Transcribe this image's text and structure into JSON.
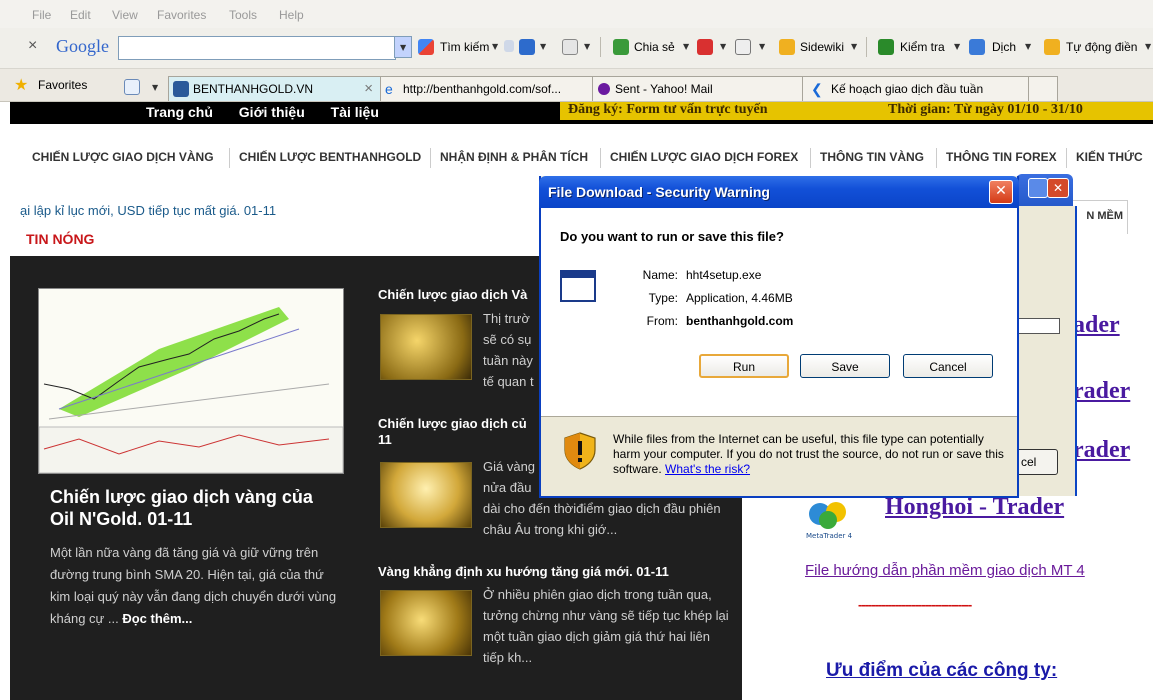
{
  "menubar": {
    "items": [
      "File",
      "Edit",
      "View",
      "Favorites",
      "Tools",
      "Help"
    ]
  },
  "google_toolbar": {
    "close": "×",
    "brand": "Google",
    "search_value": "",
    "search_label": "Tìm kiếm",
    "share_label": "Chia sẻ",
    "sidewiki_label": "Sidewiki",
    "check_label": "Kiểm tra",
    "translate_label": "Dịch",
    "autofill_label": "Tự động điền"
  },
  "favorites_bar": {
    "favorites_label": "Favorites",
    "tabs": [
      {
        "label": "BENTHANHGOLD.VN",
        "close": "×"
      },
      {
        "label": "http://benthanhgold.com/sof..."
      },
      {
        "label": "Sent - Yahoo! Mail"
      },
      {
        "label": "Kế hoạch giao dịch đầu tuần"
      }
    ]
  },
  "site": {
    "top_nav": [
      "Trang chủ",
      "Giới thiệu",
      "Tài liệu"
    ],
    "marquee_left": "Đăng ký:   Form tư vấn trực tuyến",
    "marquee_right": "Thời gian: Từ ngày 01/10 - 31/10",
    "main_menu": [
      "CHIẾN LƯỢC GIAO DỊCH VÀNG",
      "CHIẾN LƯỢC BENTHANHGOLD",
      "NHẬN ĐỊNH & PHÂN TÍCH",
      "CHIẾN LƯỢC GIAO DỊCH FOREX",
      "THÔNG TIN VÀNG",
      "THÔNG TIN FOREX",
      "KIẾN THỨC"
    ],
    "ticker": "ại lập kỉ lục mới, USD tiếp tục mất giá. 01-11",
    "hot_news": "TIN NÓNG",
    "featured": {
      "title": "Chiến lược giao dịch vàng của Oil N'Gold. 01-11",
      "body": "Một lần nữa vàng đã tăng giá và giữ vững trên đường trung bình SMA 20. Hiện tại, giá của thứ kim loại quý này vẫn đang dịch chuyển dưới vùng kháng cự ...",
      "read_more": "Đọc thêm..."
    },
    "articles": [
      {
        "title": "Chiến lược giao dịch Và",
        "text": "Thị trườ\nsẽ có sụ\ntuần này\ntế quan t"
      },
      {
        "title": "Chiến lược giao dịch củ",
        "title2": "11",
        "text": "Giá vàng\nnửa đầu\ndài cho đến thờiđiểm giao dịch đầu phiên châu Âu trong khi giớ..."
      },
      {
        "title": "Vàng khẳng định xu hướng tăng giá mới. 01-11",
        "text": "Ở nhiều phiên giao dịch trong tuần qua, tưởng chừng như vàng sẽ tiếp tục khép lại một tuần giao dịch giảm giá thứ hai liên tiếp kh..."
      }
    ],
    "right": {
      "tab_label": "N MỀM",
      "traders": [
        "ader",
        "rader",
        "rader",
        "Honghoi - Trader"
      ],
      "logo_caption": "MetaTrader 4",
      "mt4_link": "File hướng dẫn phần mềm giao dịch MT 4",
      "dashes": "----------------------------------",
      "advantages": "Ưu điểm của các công ty:"
    }
  },
  "behind_window": {
    "button_partial": "cel"
  },
  "dialog": {
    "title": "File Download - Security Warning",
    "close": "✕",
    "question": "Do you want to run or save this file?",
    "name_label": "Name:",
    "name_value": "hht4setup.exe",
    "type_label": "Type:",
    "type_value": "Application, 4.46MB",
    "from_label": "From:",
    "from_value": "benthanhgold.com",
    "run": "Run",
    "save": "Save",
    "cancel": "Cancel",
    "warning": "While files from the Internet can be useful, this file type can potentially harm your computer. If you do not trust the source, do not run or save this software.",
    "risk_link": "What's the risk?"
  },
  "colors": {
    "dialog_title": "#0a44c8",
    "hot_news": "#c8171a",
    "dark_panel": "#1f1f1f",
    "marquee": "#e6c300"
  }
}
